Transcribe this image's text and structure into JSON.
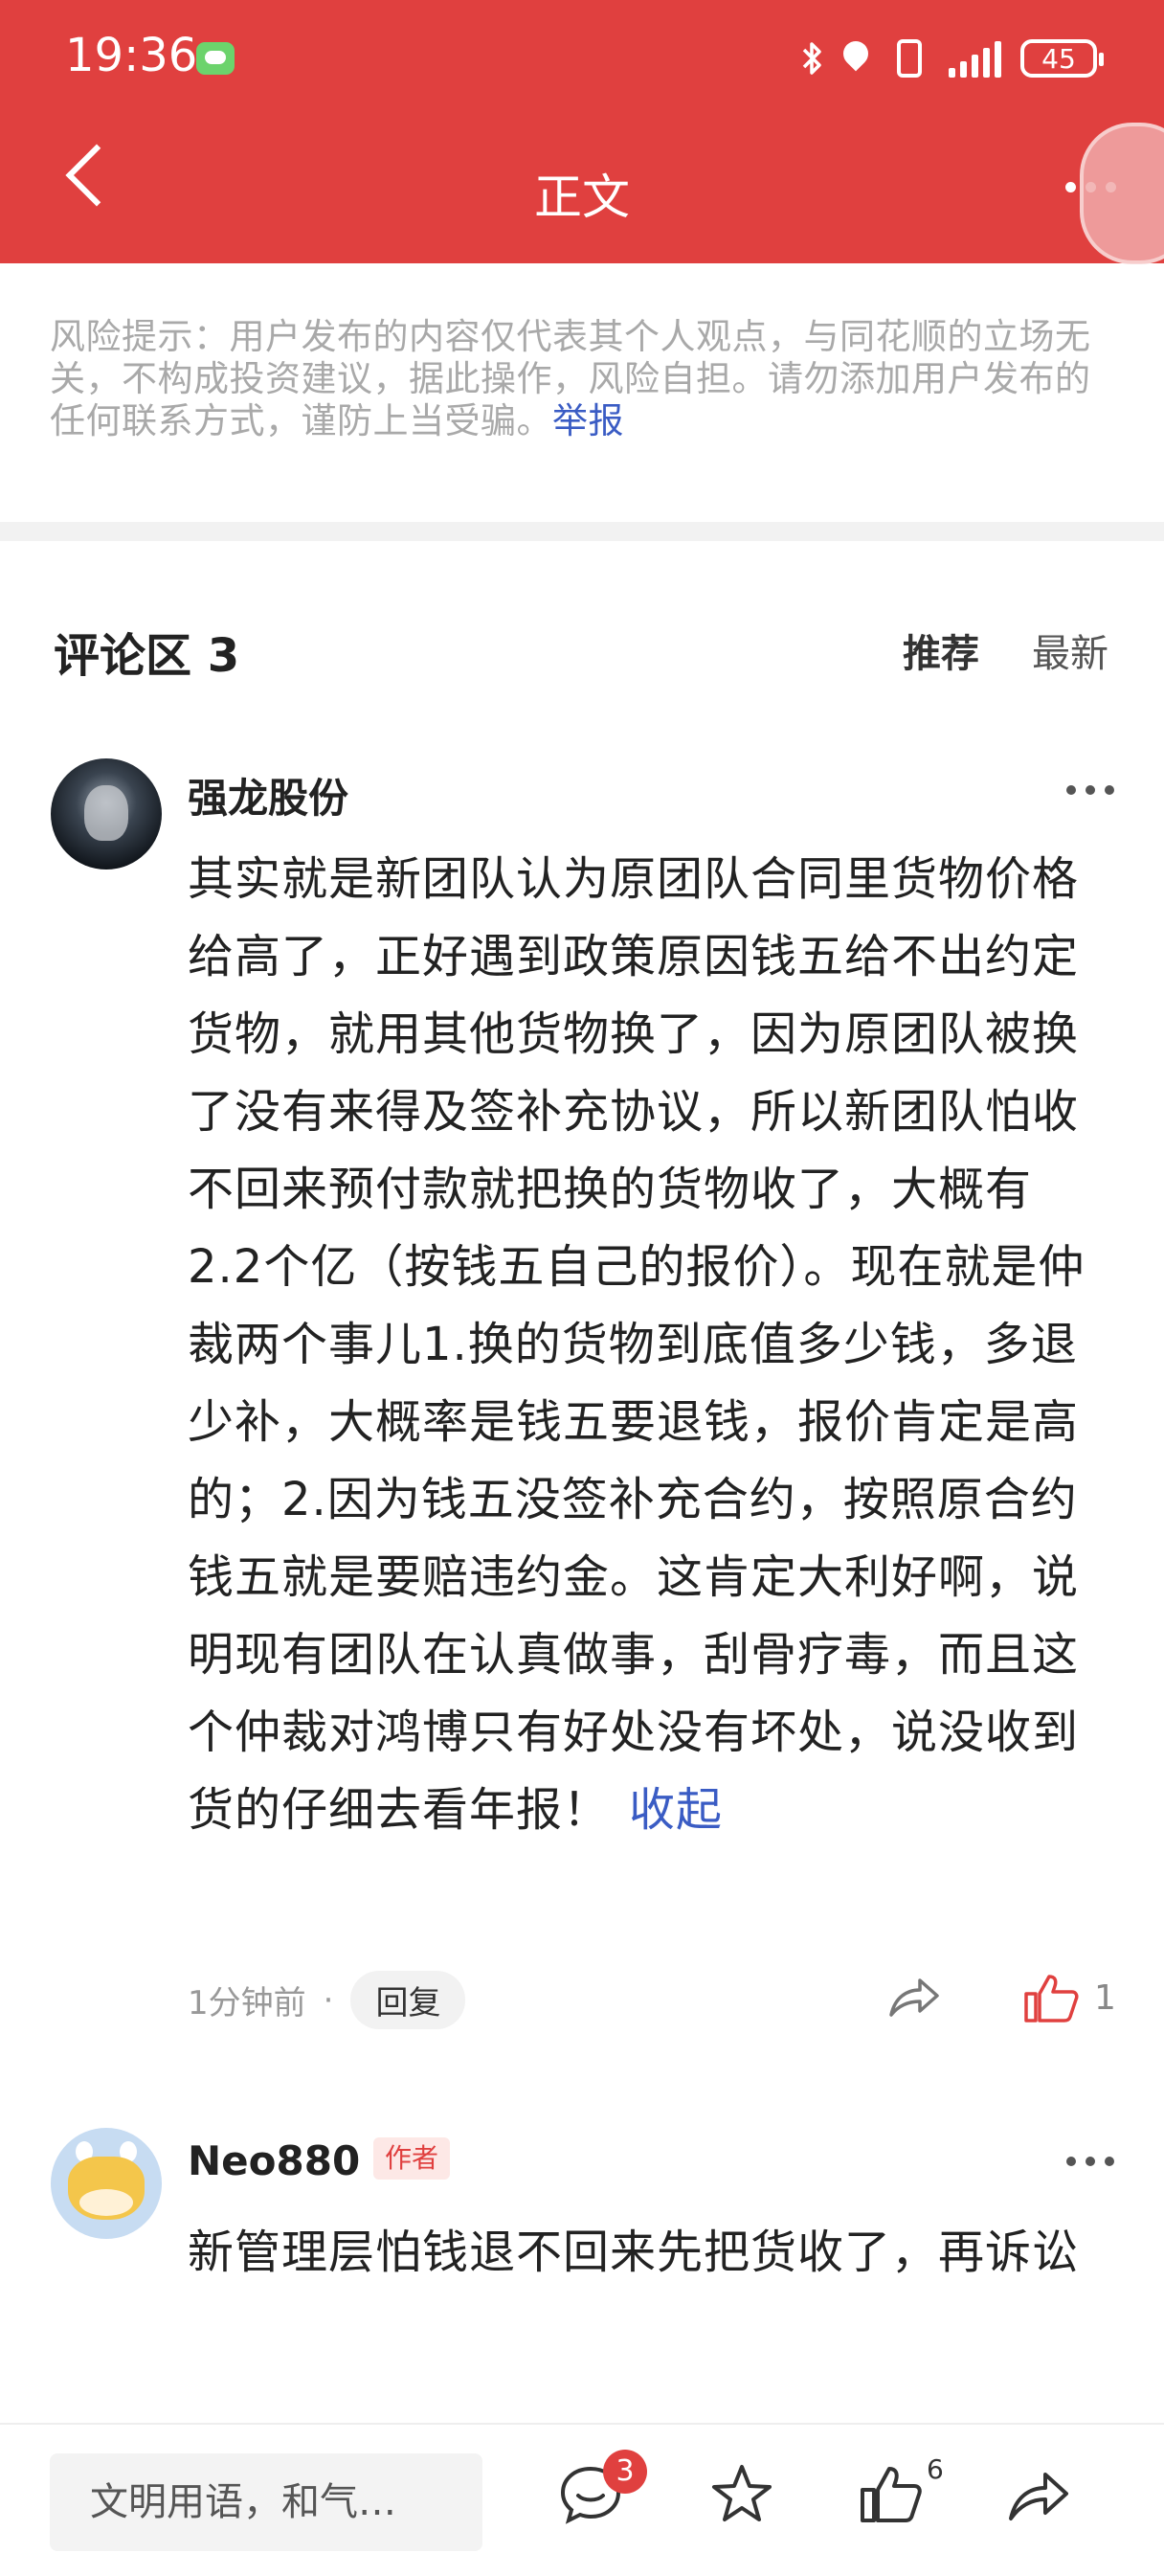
{
  "status_bar": {
    "time": "19:36",
    "battery": "45"
  },
  "header": {
    "title": "正文"
  },
  "risk_notice": {
    "text": "风险提示：用户发布的内容仅代表其个人观点，与同花顺的立场无关，不构成投资建议，据此操作，风险自担。请勿添加用户发布的任何联系方式，谨防上当受骗。",
    "report_link": "举报"
  },
  "comments_section": {
    "title": "评论区 3",
    "sort_recommended": "推荐",
    "sort_latest": "最新"
  },
  "comments": [
    {
      "username": "强龙股份",
      "text": "其实就是新团队认为原团队合同里货物价格给高了，正好遇到政策原因钱五给不出约定货物，就用其他货物换了，因为原团队被换了没有来得及签补充协议，所以新团队怕收不回来预付款就把换的货物收了，大概有2.2个亿（按钱五自己的报价）。现在就是仲裁两个事儿1.换的货物到底值多少钱，多退少补，大概率是钱五要退钱，报价肯定是高的；2.因为钱五没签补充合约，按照原合约钱五就是要赔违约金。这肯定大利好啊，说明现有团队在认真做事，刮骨疗毒，而且这个仲裁对鸿博只有好处没有坏处，说没收到货的仔细去看年报！",
      "collapse_label": "收起",
      "time": "1分钟前",
      "separator": "·",
      "reply_label": "回复",
      "likes": "1"
    },
    {
      "username": "Neo880",
      "author_tag": "作者",
      "text": "新管理层怕钱退不回来先把货收了，再诉讼"
    }
  ],
  "bottom_bar": {
    "input_placeholder": "文明用语，和气…",
    "comment_count": "3",
    "like_count": "6"
  },
  "colors": {
    "brand_red": "#e0403f",
    "link_blue": "#3a5cc4"
  }
}
